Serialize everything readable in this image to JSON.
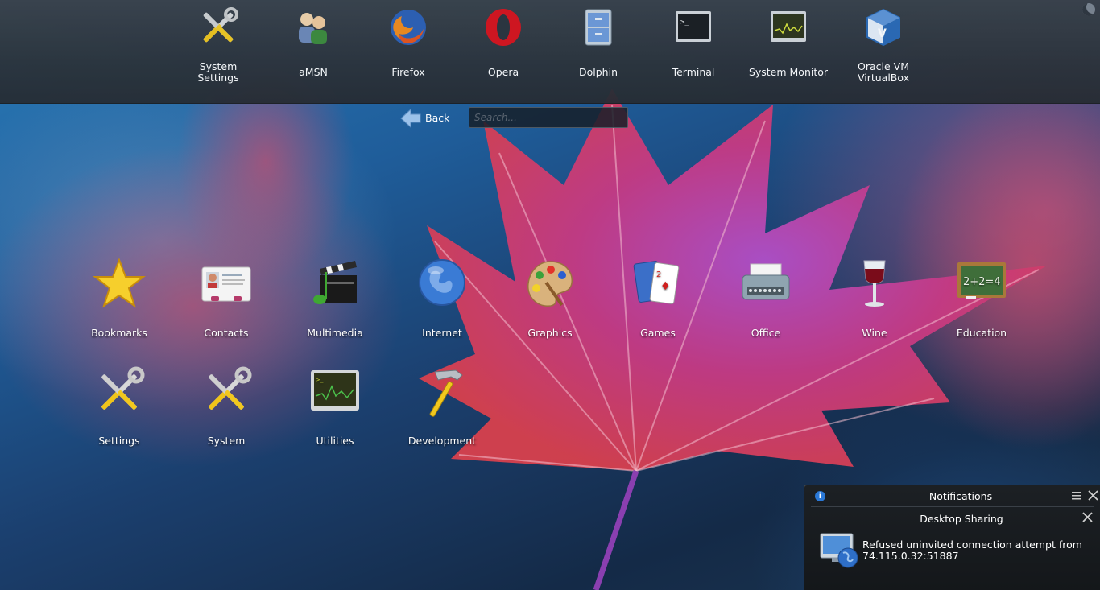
{
  "favorites": [
    {
      "label": "System Settings",
      "icon": "tools-icon"
    },
    {
      "label": "aMSN",
      "icon": "amsn-users-icon"
    },
    {
      "label": "Firefox",
      "icon": "firefox-icon"
    },
    {
      "label": "Opera",
      "icon": "opera-icon"
    },
    {
      "label": "Dolphin",
      "icon": "dolphin-cabinet-icon"
    },
    {
      "label": "Terminal",
      "icon": "terminal-icon"
    },
    {
      "label": "System Monitor",
      "icon": "system-monitor-icon"
    },
    {
      "label": "Oracle VM VirtualBox",
      "icon": "virtualbox-icon"
    }
  ],
  "navigation": {
    "back_label": "Back",
    "search_placeholder": "Search..."
  },
  "categories": [
    {
      "label": "Bookmarks",
      "icon": "star-icon"
    },
    {
      "label": "Contacts",
      "icon": "address-card-icon"
    },
    {
      "label": "Multimedia",
      "icon": "clapperboard-icon"
    },
    {
      "label": "Internet",
      "icon": "globe-icon"
    },
    {
      "label": "Graphics",
      "icon": "palette-icon"
    },
    {
      "label": "Games",
      "icon": "playing-cards-icon"
    },
    {
      "label": "Office",
      "icon": "typewriter-icon"
    },
    {
      "label": "Wine",
      "icon": "wine-glass-icon"
    },
    {
      "label": "Education",
      "icon": "chalkboard-icon"
    },
    {
      "label": "Settings",
      "icon": "tools-icon"
    },
    {
      "label": "System",
      "icon": "tools-icon"
    },
    {
      "label": "Utilities",
      "icon": "system-monitor-icon"
    },
    {
      "label": "Development",
      "icon": "hammer-icon"
    }
  ],
  "notifications": {
    "panel_title": "Notifications",
    "app_title": "Desktop Sharing",
    "message_line1": "Refused uninvited connection attempt from",
    "message_line2": "74.115.0.32:51887"
  },
  "colors": {
    "panel_bg": "#2c333b",
    "text": "#ffffff",
    "leaf": "#c8336e",
    "wallpaper_blue": "#1f5d9a"
  }
}
